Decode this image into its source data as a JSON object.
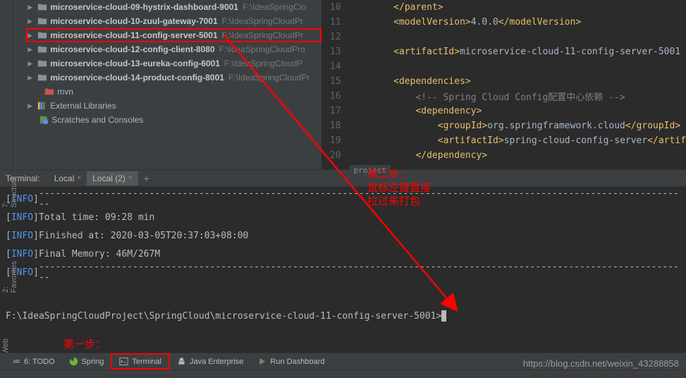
{
  "tree": {
    "items": [
      {
        "name": "microservice-cloud-09-hystrix-dashboard-9001",
        "path": "F:\\IdeaSpringClo"
      },
      {
        "name": "microservice-cloud-10-zuul-gateway-7001",
        "path": "F:\\IdeaSpringCloudPr"
      },
      {
        "name": "microservice-cloud-11-config-server-5001",
        "path": "F:\\IdeaSpringCloudPr",
        "hl": true
      },
      {
        "name": "microservice-cloud-12-config-client-8080",
        "path": "F:\\IdeaSpringCloudPro"
      },
      {
        "name": "microservice-cloud-13-eureka-config-6001",
        "path": "F:\\IdeaSpringCloudP"
      },
      {
        "name": "microservice-cloud-14-product-config-8001",
        "path": "F:\\IdeaSpringCloudPr"
      }
    ],
    "mvn": "mvn",
    "libs": "External Libraries",
    "scratches": "Scratches and Consoles"
  },
  "editor": {
    "lines": [
      {
        "n": 10,
        "indent": 2,
        "raw": "</parent>"
      },
      {
        "n": 11,
        "indent": 2,
        "raw": "<modelVersion>4.0.0</modelVersion>"
      },
      {
        "n": 12,
        "indent": 0,
        "raw": ""
      },
      {
        "n": 13,
        "indent": 2,
        "raw": "<artifactId>microservice-cloud-11-config-server-5001"
      },
      {
        "n": 14,
        "indent": 0,
        "raw": ""
      },
      {
        "n": 15,
        "indent": 2,
        "raw": "<dependencies>"
      },
      {
        "n": 16,
        "indent": 3,
        "raw": "<!-- Spring Cloud Config配置中心依赖 -->"
      },
      {
        "n": 17,
        "indent": 3,
        "raw": "<dependency>"
      },
      {
        "n": 18,
        "indent": 4,
        "raw": "<groupId>org.springframework.cloud</groupId>"
      },
      {
        "n": 19,
        "indent": 4,
        "raw": "<artifactId>spring-cloud-config-server</artif"
      },
      {
        "n": 20,
        "indent": 3,
        "raw": "</dependency>"
      }
    ],
    "breadcrumb": "project"
  },
  "terminal": {
    "title": "Terminal:",
    "tab1": "Local",
    "tab2": "Local (2)",
    "lines": {
      "l1": "[INFO] ",
      "dash": "----------------------------------------------------------------------------------------------------------------------",
      "l2": "Total time: 09:28 min",
      "l3": "Finished at: 2020-03-05T20:37:03+08:00",
      "l4": "Final Memory: 46M/267M"
    },
    "prompt": "F:\\IdeaSpringCloudProject\\SpringCloud\\microservice-cloud-11-config-server-5001>"
  },
  "bottom": {
    "todo": "6: TODO",
    "spring": "Spring",
    "terminal": "Terminal",
    "java": "Java Enterprise",
    "run": "Run Dashboard"
  },
  "sidebar": {
    "structure": "7: Structure",
    "favorites": "2: Favorites",
    "web": "Web"
  },
  "annotations": {
    "step2": "第二步：\n鼠标左键直接\n拉过来打包",
    "step1": "第一步："
  },
  "watermark": "https://blog.csdn.net/weixin_43288858"
}
